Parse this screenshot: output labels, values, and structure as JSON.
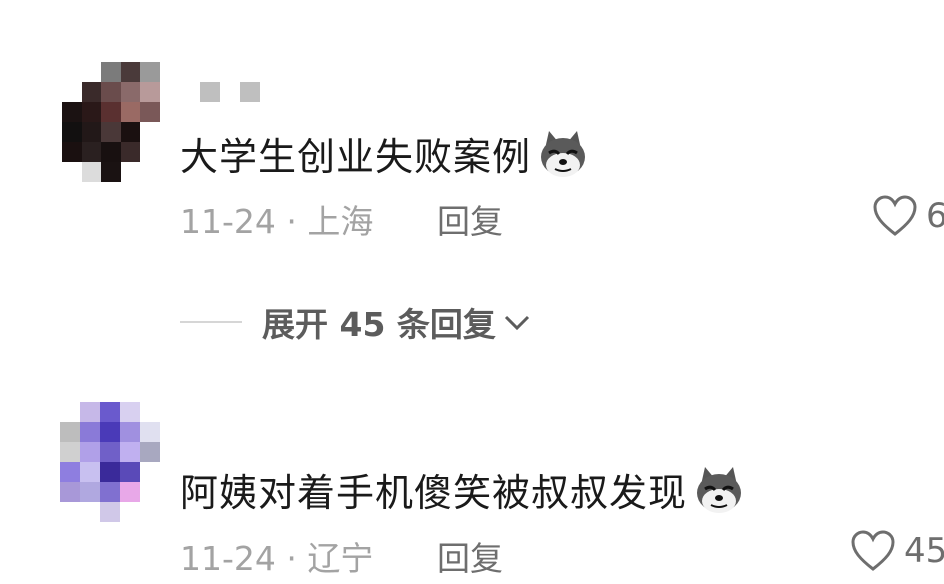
{
  "comments": [
    {
      "text": "大学生创业失败案例",
      "date": "11-24",
      "location": "上海",
      "meta": "11-24 · 上海",
      "reply_label": "回复",
      "likes": "6",
      "emoji": "dog-emoji",
      "expand_replies": "展开 45 条回复"
    },
    {
      "text": "阿姨对着手机傻笑被叔叔发现",
      "date": "11-24",
      "location": "辽宁",
      "meta": "11-24 · 辽宁",
      "reply_label": "回复",
      "likes": "45",
      "emoji": "dog-emoji"
    }
  ],
  "colors": {
    "text": "#1a1a1a",
    "meta": "#a3a3a3",
    "secondary": "#6e6e6e",
    "divider": "#d6d6d6"
  },
  "icons": [
    "heart-icon",
    "chevron-down-icon",
    "dog-emoji"
  ]
}
